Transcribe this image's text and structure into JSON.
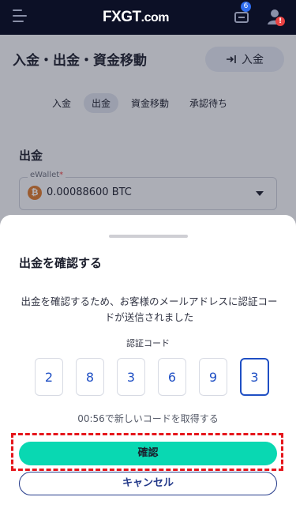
{
  "header": {
    "logo_fx": "FX",
    "logo_gt": "GT",
    "logo_dom": ".com",
    "ticket_badge": "6",
    "user_badge": "!"
  },
  "page": {
    "title": "入金・出金・資金移動",
    "deposit_button": "入金",
    "tabs": [
      {
        "label": "入金",
        "active": false
      },
      {
        "label": "出金",
        "active": true
      },
      {
        "label": "資金移動",
        "active": false
      },
      {
        "label": "承認待ち",
        "active": false
      }
    ],
    "section_title": "出金",
    "wallet": {
      "label": "eWallet",
      "required_mark": "*",
      "value": "0.00088600 BTC",
      "coin_symbol": "₿"
    }
  },
  "modal": {
    "title": "出金を確認する",
    "description": "出金を確認するため、お客様のメールアドレスに認証コードが送信されました",
    "code_label": "認証コード",
    "code_digits": [
      "2",
      "8",
      "3",
      "6",
      "9",
      "3"
    ],
    "resend_text": "00:56で新しいコードを取得する",
    "confirm_button": "確認",
    "cancel_button": "キャンセル"
  },
  "colors": {
    "topbar": "#0c1026",
    "confirm": "#09d8b2",
    "highlight": "#e5161c",
    "link_blue": "#1f4fc4"
  }
}
